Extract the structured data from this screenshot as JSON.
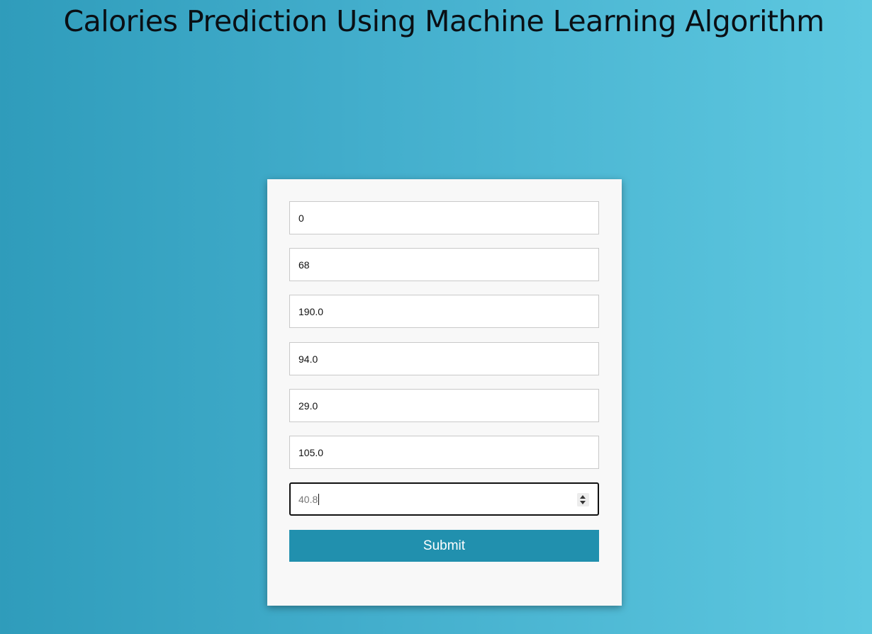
{
  "header": {
    "title": "Calories Prediction Using Machine Learning Algorithm"
  },
  "form": {
    "fields": [
      {
        "value": "0"
      },
      {
        "value": "68"
      },
      {
        "value": "190.0"
      },
      {
        "value": "94.0"
      },
      {
        "value": "29.0"
      },
      {
        "value": "105.0"
      },
      {
        "value": "40.8"
      }
    ],
    "submit_label": "Submit"
  },
  "colors": {
    "background_start": "#2f9cbb",
    "background_end": "#5ec8e0",
    "button": "#2190ae",
    "card": "#f8f8f8"
  }
}
